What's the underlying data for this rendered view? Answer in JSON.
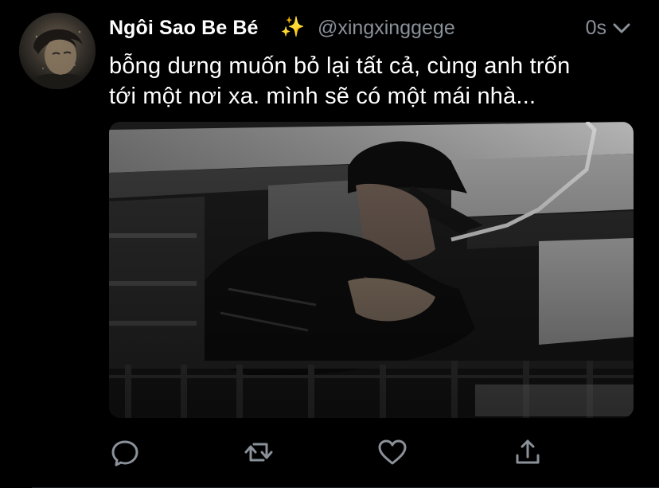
{
  "tweet": {
    "display_name": "Ngôi Sao Be Bé",
    "badge_icon": "sparkles-icon",
    "badge_glyph": "✨",
    "handle": "@xingxinggege",
    "timestamp": "0s",
    "text_lines": [
      "bỗng dưng muốn bỏ lại tất cả, cùng anh trốn",
      "tới một nơi xa. mình sẽ có một mái nhà..."
    ],
    "media_description_icon": "photo-icon"
  },
  "actions": {
    "reply_icon": "reply-icon",
    "retweet_icon": "retweet-icon",
    "like_icon": "heart-icon",
    "share_icon": "share-icon"
  },
  "colors": {
    "background": "#000000",
    "primary_text": "#ffffff",
    "secondary_text": "#8a9199",
    "icon_gray": "#8a9199"
  }
}
